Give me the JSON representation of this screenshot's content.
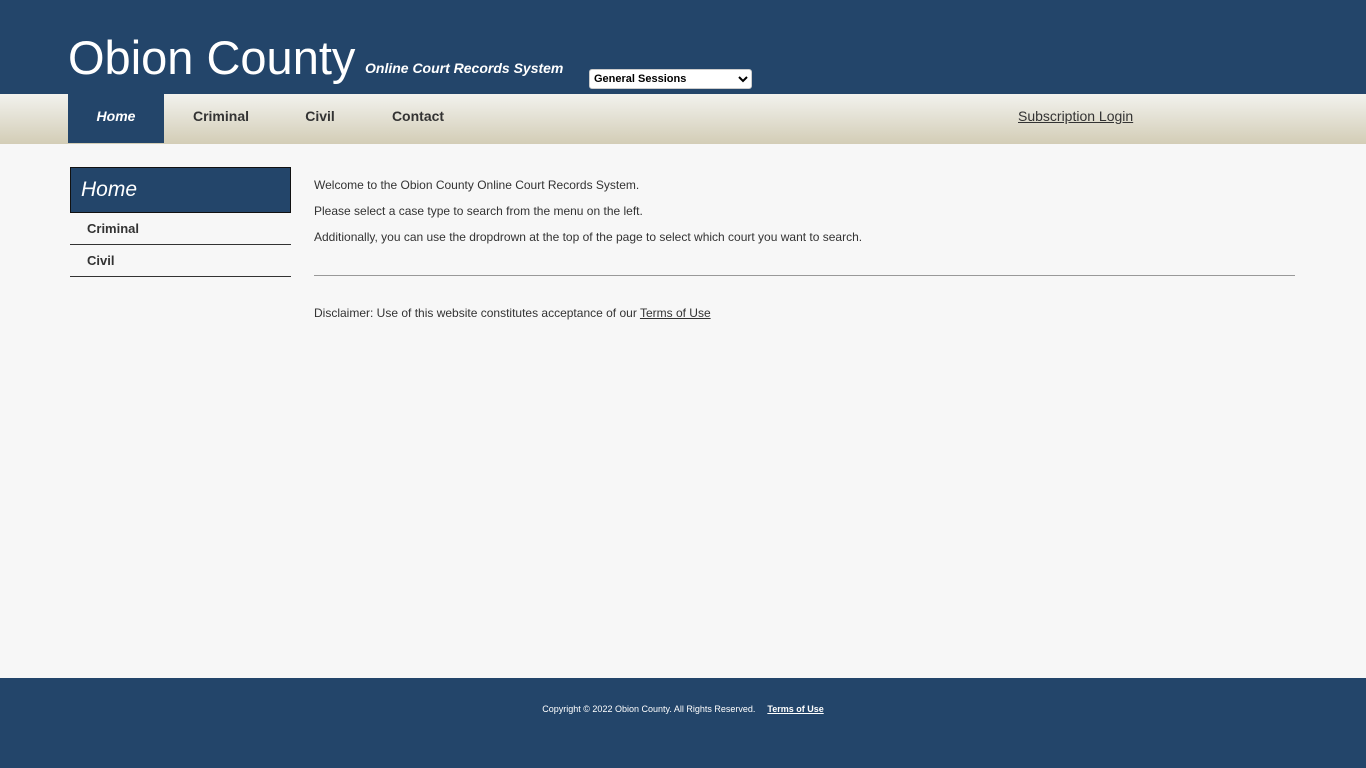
{
  "header": {
    "title": "Obion County",
    "subtitle": "Online Court Records System",
    "court_select": {
      "selected": "General Sessions"
    }
  },
  "nav": {
    "items": [
      {
        "label": "Home"
      },
      {
        "label": "Criminal"
      },
      {
        "label": "Civil"
      },
      {
        "label": "Contact"
      }
    ],
    "login": "Subscription Login"
  },
  "sidebar": {
    "heading": "Home",
    "items": [
      {
        "label": "Criminal"
      },
      {
        "label": "Civil"
      }
    ]
  },
  "main": {
    "lines": [
      "Welcome to the Obion County Online Court Records System.",
      "Please select a case type to search from the menu on the left.",
      "Additionally, you can use the dropdrown at the top of the page to select which court you want to search."
    ],
    "disclaimer": "Disclaimer: Use of this website constitutes acceptance of our ",
    "disclaimer_link": "Terms of Use"
  },
  "footer": {
    "copyright": "Copyright © 2022 Obion County. All Rights Reserved.",
    "terms": "Terms of Use"
  },
  "colors": {
    "brand": "#23456a"
  }
}
